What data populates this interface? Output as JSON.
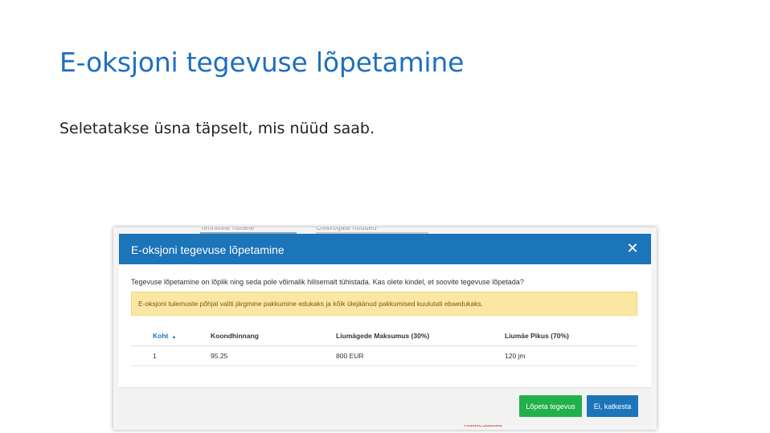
{
  "slide": {
    "title": "E-oksjoni tegevuse lõpetamine",
    "subtitle": "Seletatakse üsna täpselt, mis nüüd saab."
  },
  "background": {
    "tabs": [
      "Tehniliste nõuete",
      "Osavõtjate nõuded"
    ],
    "status": "Katkestatud"
  },
  "modal": {
    "title": "E-oksjoni tegevuse lõpetamine",
    "close_glyph": "✕",
    "confirm_text": "Tegevuse lõpetamine on lõplik ning seda pole võimalik hilisemalt tühistada. Kas olete kindel, et soovite tegevuse lõpetada?",
    "alert_text": "E-oksjoni tulemuste põhjal valiti järgmine pakkumine edukaks ja kõik ülejäänud pakkumised kuulutati ebaedukaks.",
    "table": {
      "headers": [
        "Koht",
        "Koondhinnang",
        "Liumägede Maksumus (30%)",
        "Liumäe Pikus (70%)"
      ],
      "sort_glyph": "▲",
      "rows": [
        [
          "1",
          "95.25",
          "800 EUR",
          "120 jm"
        ]
      ]
    },
    "buttons": {
      "end": "Lõpeta tegevus",
      "cancel": "Ei, katkesta"
    }
  },
  "colors": {
    "title_blue": "#1f6fbf",
    "header_blue": "#1c74b9",
    "success_green": "#21b04a",
    "alert_yellow": "#fbe7a3"
  }
}
